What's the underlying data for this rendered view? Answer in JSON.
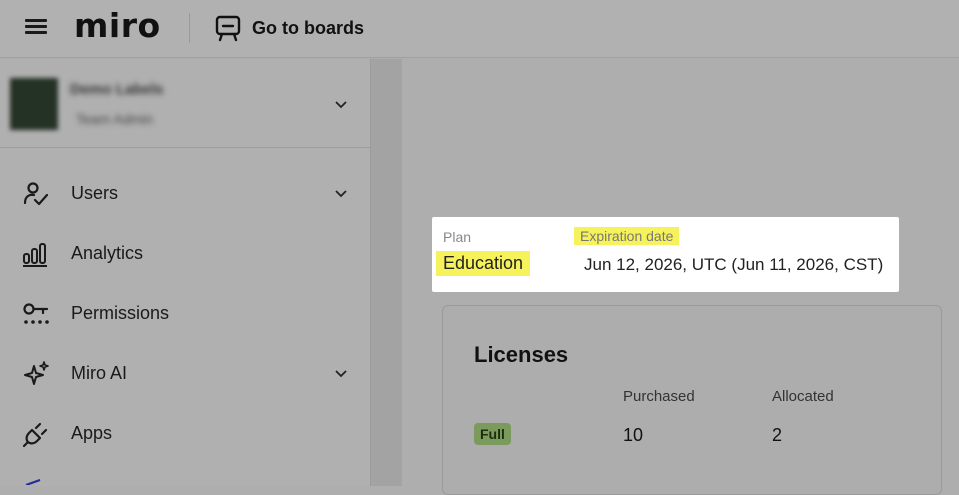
{
  "header": {
    "menu_icon": "hamburger-icon",
    "logo_text": "miro",
    "go_to_boards_label": "Go to boards",
    "go_to_boards_icon": "board-icon"
  },
  "sidebar": {
    "account": {
      "name": "Demo Labels",
      "role": "Team Admin"
    },
    "items": [
      {
        "label": "Users",
        "icon": "users-icon",
        "expandable": true
      },
      {
        "label": "Analytics",
        "icon": "analytics-icon",
        "expandable": false
      },
      {
        "label": "Permissions",
        "icon": "permissions-icon",
        "expandable": false
      },
      {
        "label": "Miro AI",
        "icon": "sparkles-icon",
        "expandable": true
      },
      {
        "label": "Apps",
        "icon": "plug-icon",
        "expandable": false
      }
    ]
  },
  "plan": {
    "plan_caption": "Plan",
    "plan_value": "Education",
    "expiration_caption": "Expiration date",
    "expiration_value": "Jun 12, 2026, UTC (Jun 11, 2026, CST)"
  },
  "licenses": {
    "title": "Licenses",
    "columns": [
      "Purchased",
      "Allocated"
    ],
    "rows": [
      {
        "type": "Full",
        "purchased": "10",
        "allocated": "2"
      }
    ]
  },
  "colors": {
    "highlight": "#f6f25b",
    "full_badge": "#7b9b5c",
    "overlay": "#aeaeae"
  }
}
